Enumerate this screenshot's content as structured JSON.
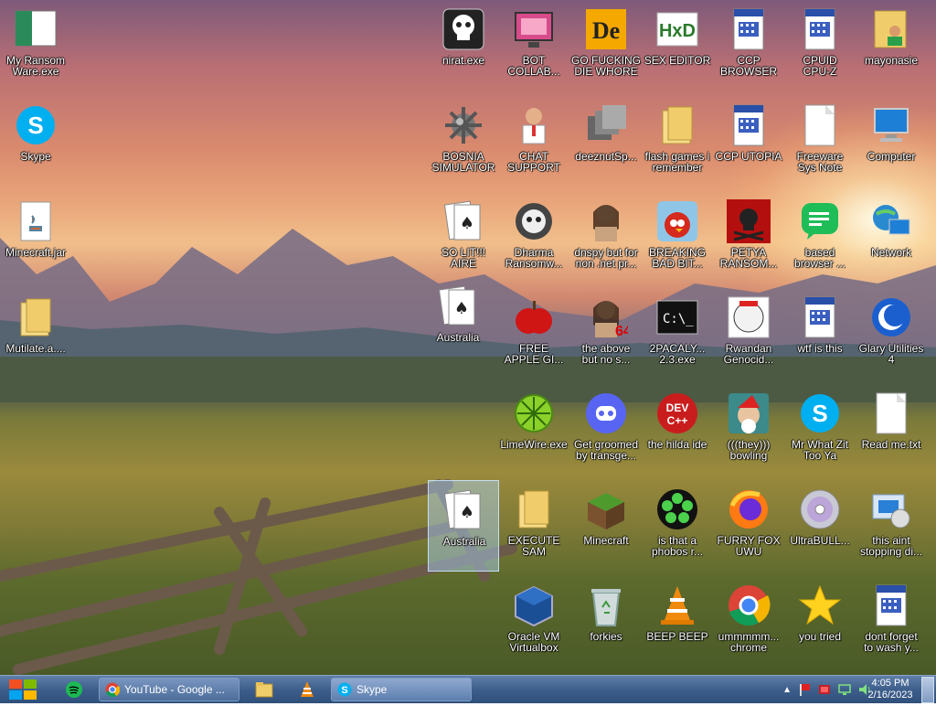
{
  "desktop_icons": [
    {
      "label": "My Ransom\nWare.exe",
      "icon": "green-white-app-icon"
    },
    {
      "label": "Skype",
      "icon": "skype-icon"
    },
    {
      "label": "Minecraft.jar",
      "icon": "java-file-icon"
    },
    {
      "label": "Mutilate.a....",
      "icon": "folder-icon"
    },
    {
      "label": "nirat.exe",
      "icon": "skull-icon"
    },
    {
      "label": "BOT\nCOLLAB...",
      "icon": "pink-monitor-icon"
    },
    {
      "label": "GO FUCKING\nDIE WHORE",
      "icon": "de-app-icon"
    },
    {
      "label": "SEX EDITOR",
      "icon": "hxd-editor-icon"
    },
    {
      "label": "CCP\nBROWSER",
      "icon": "document-app-icon"
    },
    {
      "label": "CPUID\nCPU-Z",
      "icon": "document-app-icon"
    },
    {
      "label": "mayonasie",
      "icon": "user-folder-icon"
    },
    {
      "label": "BOSNIA\nSIMULATOR",
      "icon": "spiked-mine-icon"
    },
    {
      "label": "CHAT\nSUPPORT",
      "icon": "doctor-icon"
    },
    {
      "label": "deeznutSp...",
      "icon": "stacked-windows-icon"
    },
    {
      "label": "flash games i\nremember",
      "icon": "folder-icon"
    },
    {
      "label": "CCP UTOPIA",
      "icon": "document-app-icon"
    },
    {
      "label": "Freeware\nSys Note",
      "icon": "blank-document-icon"
    },
    {
      "label": "Computer",
      "icon": "computer-icon"
    },
    {
      "label": "SO LIT!!!\nAIRE",
      "icon": "cards-icon"
    },
    {
      "label": "Dharma\nRansomw...",
      "icon": "robot-skull-icon"
    },
    {
      "label": "dnspy but for\nnon .net pr...",
      "icon": "portrait-icon"
    },
    {
      "label": "BREAKING\nBAD BIT...",
      "icon": "angry-birds-icon"
    },
    {
      "label": "PETYA\nRANSOM...",
      "icon": "red-skull-icon"
    },
    {
      "label": "based\nbrowser ...",
      "icon": "green-chat-icon"
    },
    {
      "label": "Network",
      "icon": "network-icon"
    },
    {
      "label": "Australia",
      "icon": "spider-cards-icon"
    },
    {
      "label": "FREE\nAPPLE GI...",
      "icon": "apple-icon"
    },
    {
      "label": "the above\nbut no s...",
      "icon": "portrait-64-icon"
    },
    {
      "label": "2PACALY...\n2.3.exe",
      "icon": "console-icon"
    },
    {
      "label": "Rwandan\nGenocid...",
      "icon": "meme-face-icon"
    },
    {
      "label": "wtf is this",
      "icon": "document-app-icon"
    },
    {
      "label": "Glary Utilities\n4",
      "icon": "glary-icon"
    },
    {
      "label": "LimeWire.exe",
      "icon": "limewire-icon"
    },
    {
      "label": "Get groomed\nby transge...",
      "icon": "discord-icon"
    },
    {
      "label": "the hilda ide",
      "icon": "devcpp-icon"
    },
    {
      "label": "(((they)))\nbowling",
      "icon": "santa-icon"
    },
    {
      "label": "Mr What Zit\nToo Ya",
      "icon": "skype-icon"
    },
    {
      "label": "Read me.txt",
      "icon": "text-file-icon"
    },
    {
      "label": "Australia",
      "icon": "spider-cards-icon"
    },
    {
      "label": "EXECUTE\nSAM",
      "icon": "folder-icon"
    },
    {
      "label": "Minecraft",
      "icon": "grass-block-icon"
    },
    {
      "label": "is that a\nphobos r...",
      "icon": "icq-flower-icon"
    },
    {
      "label": "FURRY FOX\nUWU",
      "icon": "firefox-icon"
    },
    {
      "label": "UltraBULL...",
      "icon": "disc-icon"
    },
    {
      "label": "this aint\nstopping di...",
      "icon": "installer-icon"
    },
    {
      "label": "Oracle VM\nVirtualbox",
      "icon": "virtualbox-icon"
    },
    {
      "label": "forkies",
      "icon": "recycle-bin-icon"
    },
    {
      "label": "BEEP BEEP",
      "icon": "vlc-cone-icon"
    },
    {
      "label": "ummmmm...\nchrome",
      "icon": "chrome-icon"
    },
    {
      "label": "you tried",
      "icon": "star-icon"
    },
    {
      "label": "dont forget\nto wash y...",
      "icon": "document-app-icon"
    }
  ],
  "taskbar": {
    "tasks": [
      {
        "label": "YouTube - Google ...",
        "icon": "chrome-icon"
      },
      {
        "label": "Skype",
        "icon": "skype-icon"
      }
    ],
    "clock": {
      "time": "4:05 PM",
      "date": "2/16/2023"
    }
  }
}
